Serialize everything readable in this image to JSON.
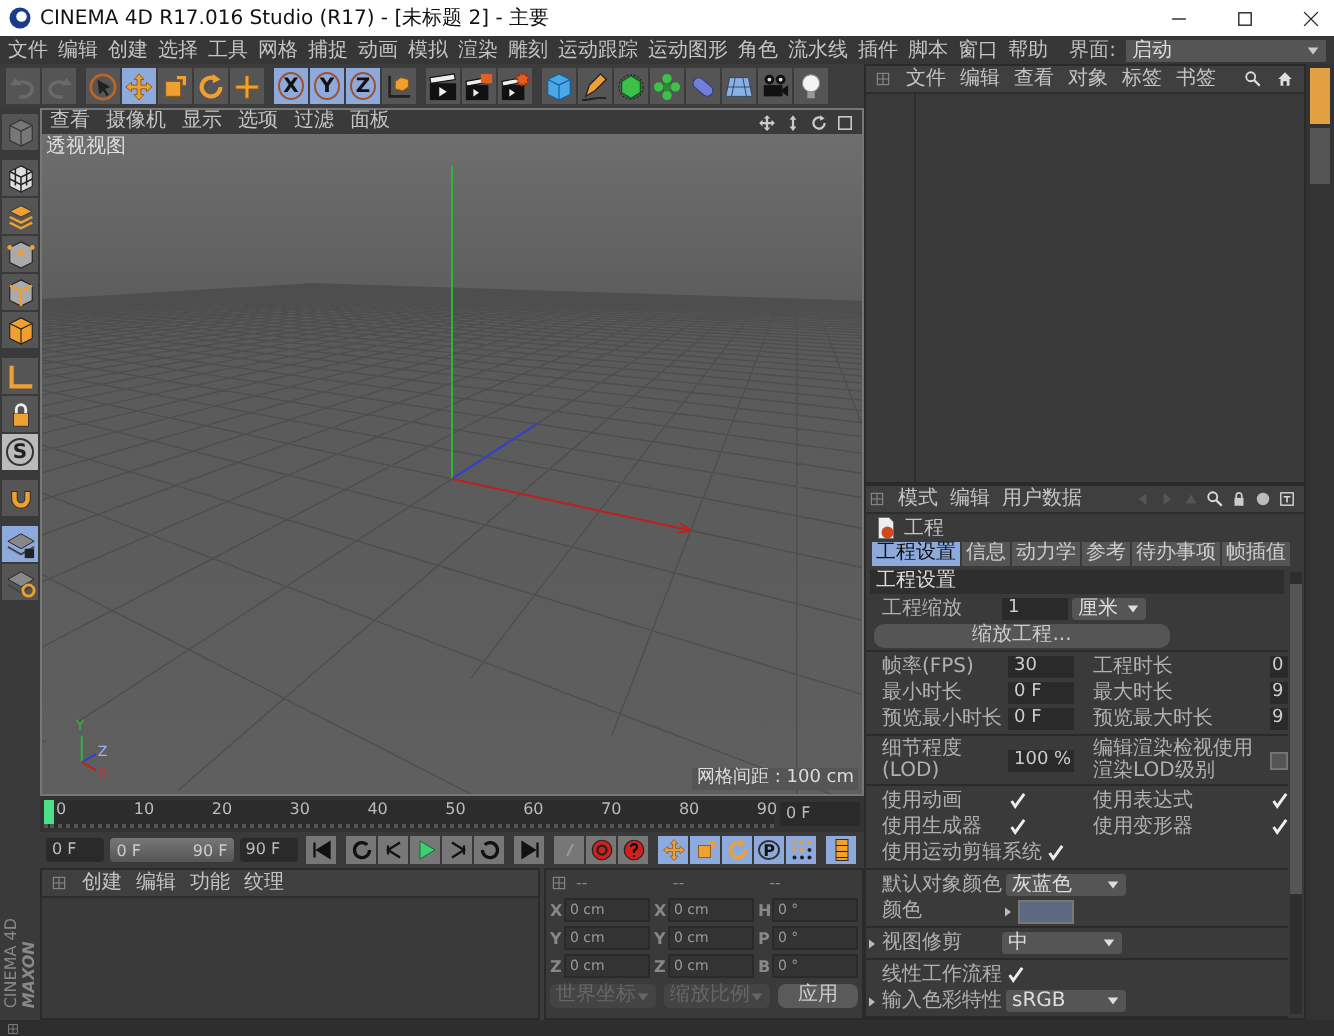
{
  "window": {
    "title": "CINEMA 4D R17.016 Studio (R17) - [未标题 2] - 主要"
  },
  "menu": [
    "文件",
    "编辑",
    "创建",
    "选择",
    "工具",
    "网格",
    "捕捉",
    "动画",
    "模拟",
    "渲染",
    "雕刻",
    "运动跟踪",
    "运动图形",
    "角色",
    "流水线",
    "插件",
    "脚本",
    "窗口",
    "帮助"
  ],
  "layout": {
    "label": "界面:",
    "value": "启动"
  },
  "toolbar": [
    [
      {
        "kind": "undo",
        "selected": false
      },
      {
        "kind": "redo",
        "selected": false
      }
    ],
    [
      {
        "kind": "select",
        "selected": false
      },
      {
        "kind": "move",
        "selected": true
      },
      {
        "kind": "scale",
        "selected": false
      },
      {
        "kind": "rotate",
        "selected": false
      },
      {
        "kind": "last",
        "selected": false
      }
    ],
    [
      {
        "kind": "letter",
        "label": "X",
        "selected": true
      },
      {
        "kind": "letter",
        "label": "Y",
        "selected": true
      },
      {
        "kind": "letter",
        "label": "Z",
        "selected": true
      },
      {
        "kind": "coord",
        "selected": false
      }
    ],
    [
      {
        "kind": "renderview",
        "selected": false
      },
      {
        "kind": "renderpv",
        "selected": false
      },
      {
        "kind": "rendersettings",
        "selected": false
      }
    ],
    [
      {
        "kind": "cube",
        "selected": false
      },
      {
        "kind": "pen",
        "selected": false
      },
      {
        "kind": "subdiv",
        "selected": false
      },
      {
        "kind": "array",
        "selected": false
      },
      {
        "kind": "deformer",
        "selected": false
      },
      {
        "kind": "floor",
        "selected": false
      },
      {
        "kind": "camera",
        "selected": false
      },
      {
        "kind": "light",
        "selected": false
      }
    ]
  ],
  "side_toolbar": [
    [
      {
        "kind": "model",
        "selected": false
      }
    ],
    [
      {
        "kind": "texture",
        "selected": false
      },
      {
        "kind": "layers",
        "selected": false
      },
      {
        "kind": "points",
        "selected": false
      },
      {
        "kind": "edges",
        "selected": false
      },
      {
        "kind": "polygons",
        "selected": false
      }
    ],
    [
      {
        "kind": "axis",
        "selected": false
      },
      {
        "kind": "padlock",
        "selected": false
      },
      {
        "kind": "letter",
        "label": "S",
        "selected": false
      }
    ],
    [
      {
        "kind": "magnet",
        "selected": false
      }
    ],
    [
      {
        "kind": "workplanelock",
        "selected": true
      },
      {
        "kind": "workplane",
        "selected": false
      }
    ]
  ],
  "viewport": {
    "menu": [
      "查看",
      "摄像机",
      "显示",
      "选项",
      "过滤",
      "面板"
    ],
    "label": "透视视图",
    "grid_info": "网格间距 : 100 cm",
    "axis_labels": [
      "Y",
      "Z",
      "X"
    ]
  },
  "timeline": {
    "ticks": [
      "0",
      "10",
      "20",
      "30",
      "40",
      "50",
      "60",
      "70",
      "80",
      "90"
    ],
    "playhead": {
      "level": 0
    },
    "frame_field": "0 F"
  },
  "transport": {
    "start_field": "0 F",
    "range": {
      "start": "0 F",
      "end": "90 F",
      "level": 1
    },
    "end_field": "90 F",
    "buttons": [
      [
        {
          "kind": "start",
          "selected": false
        }
      ],
      [
        {
          "kind": "prevkey",
          "selected": false
        },
        {
          "kind": "prevframe",
          "selected": false
        },
        {
          "kind": "play",
          "selected": false
        },
        {
          "kind": "nextframe",
          "selected": false
        },
        {
          "kind": "nextkey",
          "selected": false
        }
      ],
      [
        {
          "kind": "end",
          "selected": false
        }
      ],
      [
        {
          "kind": "record",
          "selected": false
        },
        {
          "kind": "autokey",
          "selected": false
        },
        {
          "kind": "keysel",
          "selected": false
        }
      ],
      [
        {
          "kind": "move",
          "selected": true
        },
        {
          "kind": "scale",
          "selected": true
        },
        {
          "kind": "rotate",
          "selected": true
        },
        {
          "kind": "letter",
          "label": "P",
          "selected": true
        },
        {
          "kind": "keypla",
          "selected": true
        }
      ],
      [
        {
          "kind": "timeline",
          "selected": true
        }
      ]
    ]
  },
  "material_manager": {
    "menu": [
      "创建",
      "编辑",
      "功能",
      "纹理"
    ]
  },
  "coordinates": {
    "headers": [
      "--",
      "--",
      "--"
    ],
    "rows": [
      {
        "cells": [
          {
            "axis": "X",
            "value": "0 cm"
          },
          {
            "axis": "X",
            "value": "0 cm"
          },
          {
            "axis": "H",
            "value": "0 °"
          }
        ]
      },
      {
        "cells": [
          {
            "axis": "Y",
            "value": "0 cm"
          },
          {
            "axis": "Y",
            "value": "0 cm"
          },
          {
            "axis": "P",
            "value": "0 °"
          }
        ]
      },
      {
        "cells": [
          {
            "axis": "Z",
            "value": "0 cm"
          },
          {
            "axis": "Z",
            "value": "0 cm"
          },
          {
            "axis": "B",
            "value": "0 °"
          }
        ]
      }
    ],
    "dropdowns": [
      "世界坐标",
      "缩放比例"
    ],
    "apply": "应用"
  },
  "logo": {
    "brand": "MAXON",
    "product": "CINEMA 4D"
  },
  "object_manager": {
    "menu": [
      "文件",
      "编辑",
      "查看",
      "对象",
      "标签",
      "书签"
    ]
  },
  "attributes": {
    "menu": [
      "模式",
      "编辑",
      "用户数据"
    ],
    "title": "工程",
    "tabs": [
      {
        "label": "工程设置",
        "selected": true
      },
      {
        "label": "信息",
        "selected": false
      },
      {
        "label": "动力学",
        "selected": false
      },
      {
        "label": "参考",
        "selected": false
      },
      {
        "label": "待办事项",
        "selected": false
      },
      {
        "label": "帧插值",
        "selected": false
      }
    ],
    "section": "工程设置",
    "groups": [
      [
        {
          "cells": [
            {
              "kind": "number",
              "label": "工程缩放",
              "value": "1",
              "unit": "厘米"
            }
          ]
        },
        {
          "cells": [
            {
              "kind": "button",
              "label": "缩放工程..."
            }
          ]
        }
      ],
      [
        {
          "cells": [
            {
              "kind": "number",
              "label": "帧率(FPS)",
              "value": "30"
            },
            {
              "kind": "number",
              "label": "工程时长",
              "value": "0"
            }
          ]
        },
        {
          "cells": [
            {
              "kind": "number",
              "label": "最小时长",
              "value": "0 F"
            },
            {
              "kind": "number",
              "label": "最大时长",
              "value": "9"
            }
          ]
        },
        {
          "cells": [
            {
              "kind": "number",
              "label": "预览最小时长",
              "value": "0 F"
            },
            {
              "kind": "number",
              "label": "预览最大时长",
              "value": "9"
            }
          ]
        }
      ],
      [
        {
          "cells": [
            {
              "kind": "number",
              "label": "细节程度(LOD)",
              "value": "100 %"
            },
            {
              "kind": "check",
              "label": "编辑渲染检视使用渲染LOD级别",
              "checked": false
            }
          ]
        }
      ],
      [
        {
          "cells": [
            {
              "kind": "check",
              "label": "使用动画",
              "checked": true
            },
            {
              "kind": "check",
              "label": "使用表达式",
              "checked": true
            }
          ]
        },
        {
          "cells": [
            {
              "kind": "check",
              "label": "使用生成器",
              "checked": true
            },
            {
              "kind": "check",
              "label": "使用变形器",
              "checked": true
            }
          ]
        },
        {
          "cells": [
            {
              "kind": "check",
              "label": "使用运动剪辑系统",
              "checked": true
            }
          ]
        }
      ],
      [
        {
          "cells": [
            {
              "kind": "dropdown",
              "label": "默认对象颜色",
              "value": "灰蓝色"
            }
          ]
        },
        {
          "cells": [
            {
              "kind": "swatch",
              "label": "颜色",
              "expanded": false
            }
          ]
        }
      ],
      [
        {
          "cells": [
            {
              "kind": "dropdown",
              "label": "视图修剪",
              "value": "中",
              "expanded": false
            }
          ]
        }
      ],
      [
        {
          "cells": [
            {
              "kind": "check",
              "label": "线性工作流程",
              "checked": true
            }
          ]
        },
        {
          "cells": [
            {
              "kind": "dropdown",
              "label": "输入色彩特性",
              "value": "sRGB",
              "expanded": false
            }
          ]
        }
      ]
    ]
  }
}
